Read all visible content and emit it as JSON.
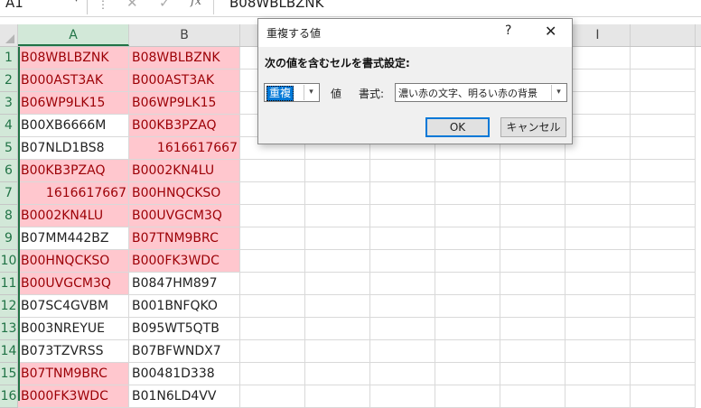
{
  "formula_bar": {
    "name_box": "A1",
    "formula": "B08WBLBZNK",
    "sep_glyph": "⋮",
    "cancel_glyph": "✕",
    "enter_glyph": "✓",
    "fx_label": "fx",
    "name_box_arrow": "▾",
    "icons": [
      "cancel-icon",
      "enter-icon",
      "fx-icon"
    ]
  },
  "columns": [
    "A",
    "B",
    "",
    "",
    "",
    "",
    "H",
    "I",
    ""
  ],
  "selected_column": "A",
  "rows": [
    {
      "num": "1",
      "a": "B08WBLBZNK",
      "b": "B08WBLBZNK"
    },
    {
      "num": "2",
      "a": "B000AST3AK",
      "b": "B000AST3AK"
    },
    {
      "num": "3",
      "a": "B06WP9LK15",
      "b": "B06WP9LK15"
    },
    {
      "num": "4",
      "a": "B00XB6666M",
      "b": "B00KB3PZAQ"
    },
    {
      "num": "5",
      "a": "B07NLD1BS8",
      "b": "1616617667"
    },
    {
      "num": "6",
      "a": "B00KB3PZAQ",
      "b": "B0002KN4LU"
    },
    {
      "num": "7",
      "a": "1616617667",
      "b": "B00HNQCKSO"
    },
    {
      "num": "8",
      "a": "B0002KN4LU",
      "b": "B00UVGCM3Q"
    },
    {
      "num": "9",
      "a": "B07MM442BZ",
      "b": "B07TNM9BRC"
    },
    {
      "num": "10",
      "a": "B00HNQCKSO",
      "b": "B000FK3WDC"
    },
    {
      "num": "11",
      "a": "B00UVGCM3Q",
      "b": "B0847HM897"
    },
    {
      "num": "12",
      "a": "B07SC4GVBM",
      "b": "B001BNFQKO"
    },
    {
      "num": "13",
      "a": "B003NREYUE",
      "b": "B095WT5QTB"
    },
    {
      "num": "14",
      "a": "B073TZVRSS",
      "b": "B07BFWNDX7"
    },
    {
      "num": "15",
      "a": "B07TNM9BRC",
      "b": "B00481D338"
    },
    {
      "num": "16",
      "a": "B000FK3WDC",
      "b": "B01N6LD4VV"
    }
  ],
  "duplicate_fill": "#ffc7ce",
  "duplicate_text": "#9c0006",
  "dialog": {
    "title": "重複する値",
    "help": "?",
    "close_glyph": "✕",
    "instruction": "次の値を含むセルを書式設定:",
    "kind_value": "重複",
    "dropdown_glyph": "▾",
    "value_label": "値",
    "format_label": "書式:",
    "format_value": "濃い赤の文字、明るい赤の背景",
    "ok_label": "OK",
    "cancel_label": "キャンセル"
  }
}
